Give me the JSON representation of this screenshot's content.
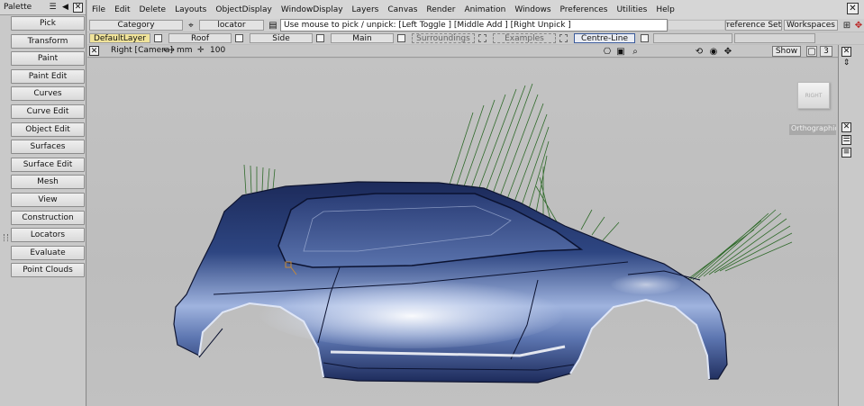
{
  "palette": {
    "title": "Palette",
    "items": [
      "Pick",
      "Transform",
      "Paint",
      "Paint Edit",
      "Curves",
      "Curve Edit",
      "Object Edit",
      "Surfaces",
      "Surface Edit",
      "Mesh",
      "View",
      "Construction",
      "Locators",
      "Evaluate",
      "Point Clouds"
    ]
  },
  "menubar": {
    "items": [
      "File",
      "Edit",
      "Delete",
      "Layouts",
      "ObjectDisplay",
      "WindowDisplay",
      "Layers",
      "Canvas",
      "Render",
      "Animation",
      "Windows",
      "Preferences",
      "Utilities",
      "Help"
    ]
  },
  "toolbar": {
    "category": "Category",
    "tool_name": "locator",
    "status": "Use mouse to pick / unpick: [Left Toggle ] [Middle Add ] [Right Unpick ]",
    "preference_sets": "Preference Sets",
    "workspaces": "Workspaces"
  },
  "layers": [
    {
      "name": "DefaultLayer",
      "state": "active"
    },
    {
      "name": "Roof",
      "state": "normal"
    },
    {
      "name": "Side",
      "state": "normal"
    },
    {
      "name": "Main",
      "state": "normal"
    },
    {
      "name": "Surroundings",
      "state": "dashed"
    },
    {
      "name": "Examples",
      "state": "dashed"
    },
    {
      "name": "Centre-Line",
      "state": "framed"
    }
  ],
  "viewport": {
    "view_name": "Right [Camera]",
    "unit": "mm",
    "scale": "100",
    "show_label": "Show",
    "count": "3",
    "viewcube_label": "RIGHT",
    "projection_label": "Orthographic"
  },
  "colors": {
    "body_dark": "#1c2a5a",
    "body_mid": "#3b5592",
    "highlight": "#e8eefa",
    "comb": "#2f6a2a",
    "viewport_bg": "#c0c0c0"
  }
}
